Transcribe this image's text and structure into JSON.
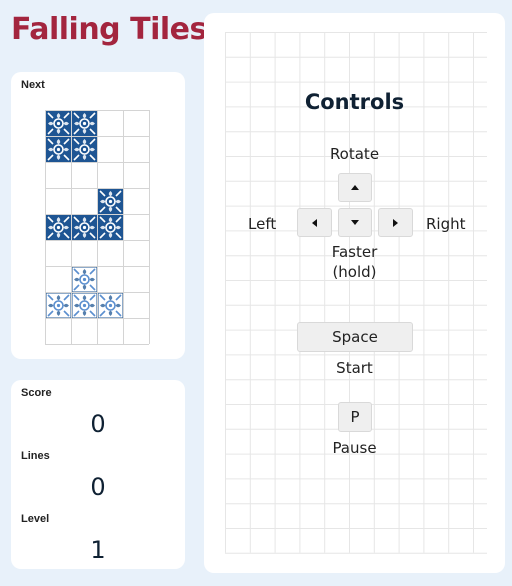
{
  "app": {
    "title": "Falling Tiles"
  },
  "next_panel": {
    "label": "Next",
    "grid": {
      "cols": 4,
      "rows": 9
    },
    "pieces": [
      {
        "name": "O",
        "style": "dark",
        "cells": [
          [
            0,
            0
          ],
          [
            1,
            0
          ],
          [
            0,
            1
          ],
          [
            1,
            1
          ]
        ]
      },
      {
        "name": "J",
        "style": "dark",
        "cells": [
          [
            2,
            3
          ],
          [
            0,
            4
          ],
          [
            1,
            4
          ],
          [
            2,
            4
          ]
        ]
      },
      {
        "name": "T",
        "style": "light",
        "cells": [
          [
            1,
            6
          ],
          [
            0,
            7
          ],
          [
            1,
            7
          ],
          [
            2,
            7
          ]
        ]
      }
    ],
    "tile_colors": {
      "dark": "#1e5593",
      "light": "#5b8fcf",
      "ink": "#ffffff"
    }
  },
  "stats": {
    "score": {
      "label": "Score",
      "value": "0"
    },
    "lines": {
      "label": "Lines",
      "value": "0"
    },
    "level": {
      "label": "Level",
      "value": "1"
    }
  },
  "board": {
    "cols": 11,
    "rows": 21
  },
  "controls": {
    "title": "Controls",
    "rotate_label": "Rotate",
    "left_label": "Left",
    "right_label": "Right",
    "faster_label_line1": "Faster",
    "faster_label_line2": "(hold)",
    "space_key": "Space",
    "start_label": "Start",
    "p_key": "P",
    "pause_label": "Pause",
    "up_key_icon": "arrow-up-icon",
    "left_key_icon": "arrow-left-icon",
    "down_key_icon": "arrow-down-icon",
    "right_key_icon": "arrow-right-icon"
  },
  "colors": {
    "accent": "#a3253e",
    "page_bg": "#e8f1fa",
    "grid_line": "#e6e6e6"
  }
}
